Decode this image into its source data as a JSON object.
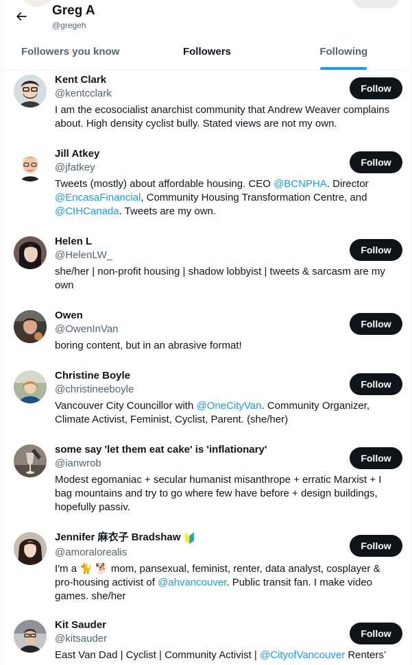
{
  "header": {
    "back_icon": "arrow-left-icon",
    "name": "Greg A",
    "handle": "@gregeh"
  },
  "tabs": [
    {
      "label": "Followers you know",
      "active": false
    },
    {
      "label": "Followers",
      "active": true
    },
    {
      "label": "Following",
      "active": false
    }
  ],
  "accent_color": "#1d9bf0",
  "follow_label": "Follow",
  "users": [
    {
      "name": "Kent Clark",
      "handle": "@kentcclark",
      "bio": [
        {
          "t": "I am the ecosocialist anarchist community that Andrew Weaver complains about. High density cyclist bully. Stated views are not my own."
        }
      ]
    },
    {
      "name": "Jill Atkey",
      "handle": "@jfatkey",
      "bio": [
        {
          "t": "Tweets (mostly) about affordable housing. CEO "
        },
        {
          "t": "@BCNPHA",
          "m": true
        },
        {
          "t": ". Director "
        },
        {
          "t": "@EncasaFinancial",
          "m": true
        },
        {
          "t": ", Community Housing Transformation Centre, and "
        },
        {
          "t": "@CIHCanada",
          "m": true
        },
        {
          "t": ". Tweets are my own."
        }
      ]
    },
    {
      "name": "Helen L",
      "handle": "@HelenLW_",
      "bio": [
        {
          "t": "she/her | non-profit housing | shadow lobbyist | tweets & sarcasm are my own"
        }
      ]
    },
    {
      "name": "Owen",
      "handle": "@OwenInVan",
      "bio": [
        {
          "t": "boring content, but in an abrasive format!"
        }
      ]
    },
    {
      "name": "Christine Boyle",
      "handle": "@christineeboyle",
      "bio": [
        {
          "t": "Vancouver City Councillor with "
        },
        {
          "t": "@OneCityVan",
          "m": true
        },
        {
          "t": ". Community Organizer, Climate Activist, Feminist, Cyclist, Parent. (she/her)"
        }
      ]
    },
    {
      "name": "some say 'let them eat cake' is 'inflationary'",
      "handle": "@ianwrob",
      "bio": [
        {
          "t": "Modest egomaniac + secular humanist misanthrope + erratic Marxist + I bag mountains and try to go where few have before + design buildings, hopefully passiv."
        }
      ]
    },
    {
      "name": "Jennifer 麻衣子 Bradshaw",
      "name_badge": "🔰",
      "handle": "@amoralorealis",
      "bio": [
        {
          "t": "I'm a 🐈 🐕 mom, pansexual, feminist, renter, data analyst, cosplayer & pro-housing activist of "
        },
        {
          "t": "@ahvancouver",
          "m": true
        },
        {
          "t": ". Public transit fan. I make video games. she/her"
        }
      ]
    },
    {
      "name": "Kit Sauder",
      "handle": "@kitsauder",
      "bio": [
        {
          "t": "East Van Dad | Cyclist | Community Activist | "
        },
        {
          "t": "@CityofVancouver",
          "m": true
        },
        {
          "t": " Renters’"
        }
      ]
    }
  ]
}
